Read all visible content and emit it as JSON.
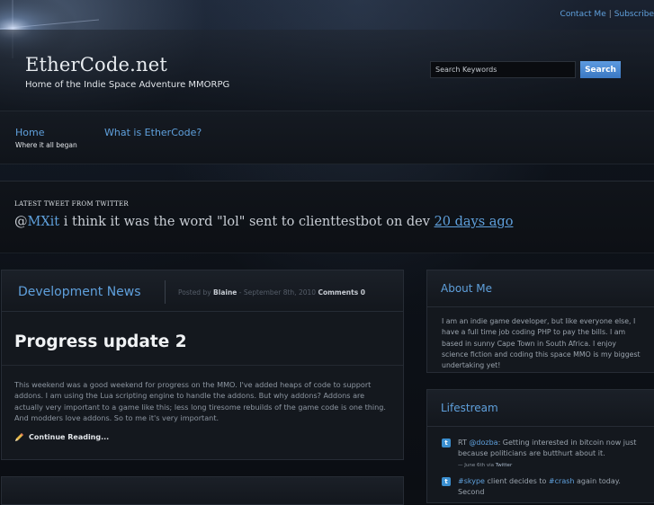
{
  "top_links": {
    "contact": "Contact Me",
    "separator": "|",
    "subscribe": "Subscribe"
  },
  "site": {
    "title": "EtherCode.net",
    "tagline": "Home of the Indie Space Adventure MMORPG"
  },
  "search": {
    "placeholder": "Search Keywords",
    "button": "Search"
  },
  "nav": [
    {
      "label": "Home",
      "sub": "Where it all began"
    },
    {
      "label": "What is EtherCode?",
      "sub": ""
    }
  ],
  "tweet": {
    "heading": "LATEST TWEET FROM TWITTER",
    "at": "@",
    "user": "MXit",
    "text": " i think it was the word \"lol\" sent to clienttestbot on dev ",
    "time": "20 days ago"
  },
  "main": {
    "section_title": "Development News",
    "meta_prefix": "Posted by ",
    "author": "Blaine",
    "meta_date": " - September 8th, 2010 ",
    "comments": "Comments 0",
    "post_title": "Progress update 2",
    "post_body": "This weekend was a good weekend for progress on the MMO. I've added heaps of code to support addons. I am using the Lua scripting engine to handle the addons. But why addons? Addons are actually very important to a game like this; less long tiresome rebuilds of the game code is one thing. And modders love addons. So to me it's very important.",
    "read_more": "Continue Reading..."
  },
  "sidebar": {
    "about_title": "About Me",
    "about_text": "I am an indie game developer, but like everyone else, I have a full time job coding PHP to pay the bills. I am based in sunny Cape Town in South Africa. I enjoy science fiction and coding this space MMO is my biggest undertaking yet!",
    "lifestream_title": "Lifestream",
    "items": [
      {
        "prefix": "RT ",
        "link": "@dozba",
        "text": ": Getting interested in bitcoin now just because politicians are butthurt about it.",
        "meta_date": "— June 6th via ",
        "meta_source": "Twitter"
      },
      {
        "prefix": "",
        "link": "#skype",
        "text_mid": " client decides to ",
        "link2": "#crash",
        "text": " again today. Second"
      }
    ]
  },
  "colors": {
    "accent": "#5fa0dc",
    "button": "#4a88d2",
    "panel": "#14181e"
  }
}
